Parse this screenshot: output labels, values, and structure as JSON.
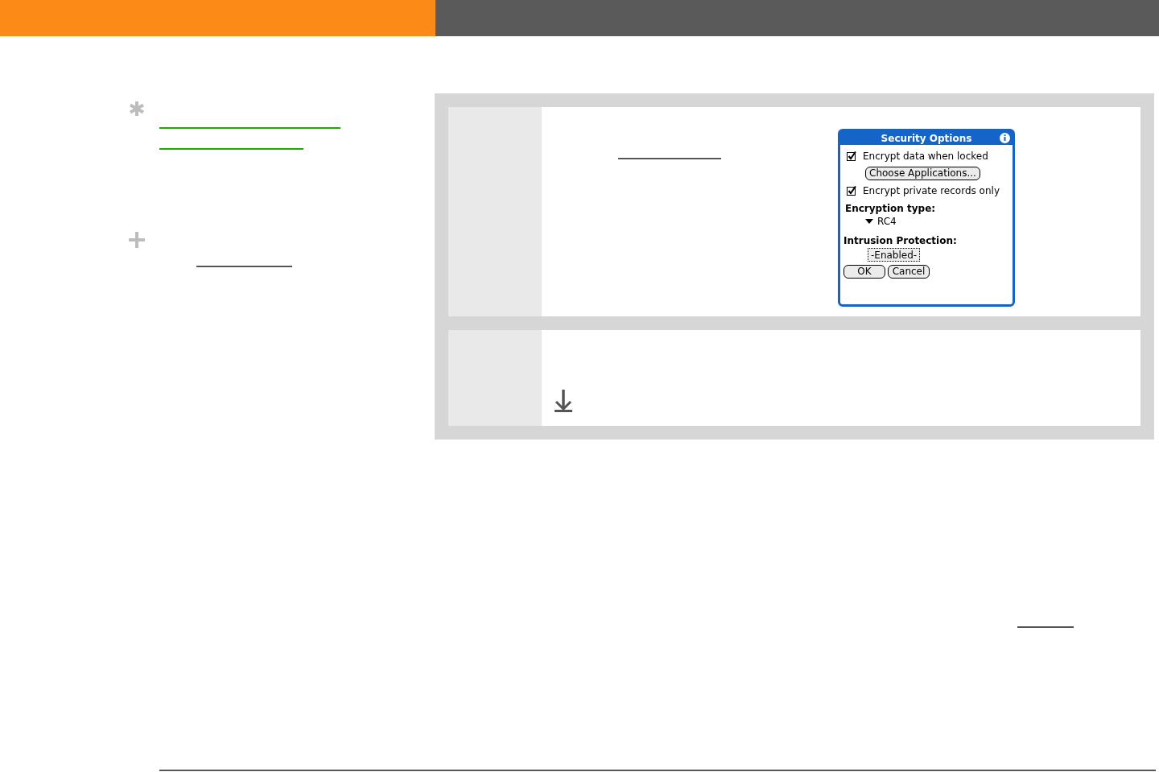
{
  "dialog": {
    "title": "Security Options",
    "options": [
      {
        "label": "Encrypt data when locked",
        "checked": true
      },
      {
        "label": "Encrypt private records only",
        "checked": true
      }
    ],
    "choose_button": "Choose Applications...",
    "encryption_label": "Encryption type:",
    "encryption_value": "RC4",
    "intrusion_label": "Intrusion Protection:",
    "intrusion_value": "-Enabled-",
    "buttons": [
      "OK",
      "Cancel"
    ]
  }
}
